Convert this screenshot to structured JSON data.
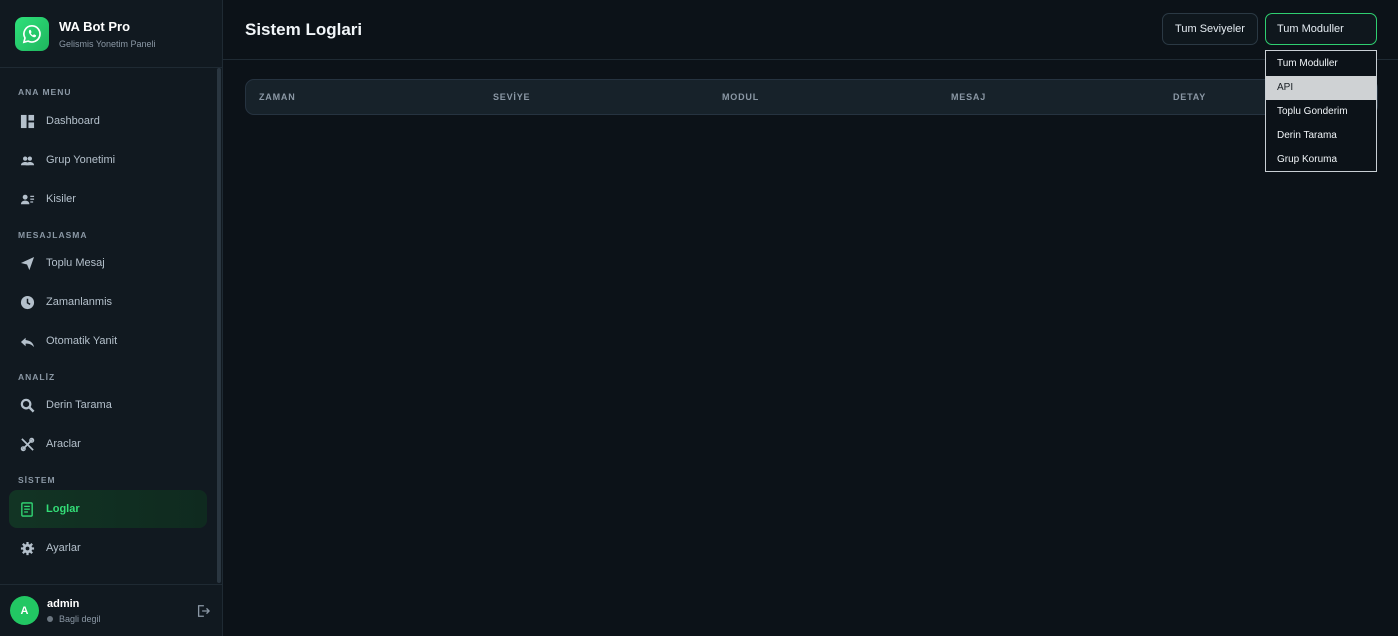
{
  "brand": {
    "title": "WA Bot Pro",
    "subtitle": "Gelismis Yonetim Paneli",
    "icon": "whatsapp-icon",
    "accent": "#25d366"
  },
  "sidebar": {
    "sections": [
      {
        "label": "ANA MENU",
        "items": [
          {
            "label": "Dashboard",
            "icon": "dashboard-icon"
          },
          {
            "label": "Grup Yonetimi",
            "icon": "group-icon"
          },
          {
            "label": "Kisiler",
            "icon": "contacts-icon"
          }
        ]
      },
      {
        "label": "MESAJLASMA",
        "items": [
          {
            "label": "Toplu Mesaj",
            "icon": "send-icon"
          },
          {
            "label": "Zamanlanmis",
            "icon": "clock-icon"
          },
          {
            "label": "Otomatik Yanit",
            "icon": "reply-icon"
          }
        ]
      },
      {
        "label": "ANALİZ",
        "items": [
          {
            "label": "Derin Tarama",
            "icon": "search-icon"
          },
          {
            "label": "Araclar",
            "icon": "tools-icon"
          }
        ]
      },
      {
        "label": "SİSTEM",
        "items": [
          {
            "label": "Loglar",
            "icon": "log-icon",
            "active": true
          },
          {
            "label": "Ayarlar",
            "icon": "gear-icon"
          }
        ]
      }
    ]
  },
  "user": {
    "initial": "A",
    "name": "admin",
    "status": "Bagli degil"
  },
  "header": {
    "title": "Sistem Loglari",
    "level_filter": "Tum Seviyeler",
    "module_filter": "Tum Moduller"
  },
  "table": {
    "columns": [
      "ZAMAN",
      "SEVİYE",
      "MODUL",
      "MESAJ",
      "DETAY"
    ]
  },
  "dropdown": {
    "options": [
      "Tum Moduller",
      "API",
      "Toplu Gonderim",
      "Derin Tarama",
      "Grup Koruma"
    ],
    "highlighted": "API"
  }
}
